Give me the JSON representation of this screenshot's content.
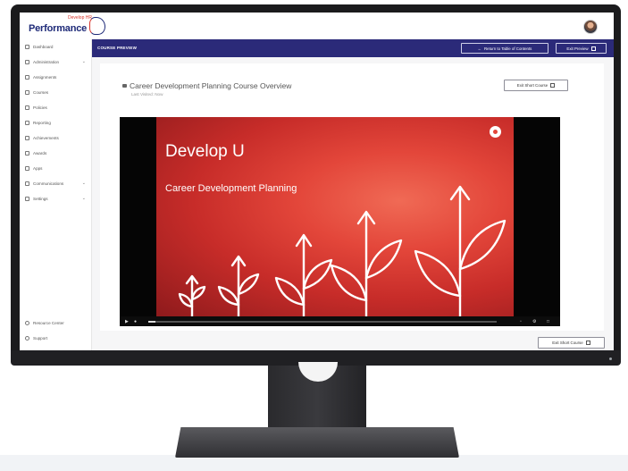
{
  "app": {
    "logo_text": "Performance",
    "logo_sub": "Develop HR"
  },
  "sidebar": {
    "items": [
      {
        "label": "Dashboard",
        "icon": "dashboard-icon"
      },
      {
        "label": "Administration",
        "icon": "admin-icon",
        "expandable": true
      },
      {
        "label": "Assignments",
        "icon": "assignments-icon"
      },
      {
        "label": "Courses",
        "icon": "courses-icon"
      },
      {
        "label": "Policies",
        "icon": "policies-icon"
      },
      {
        "label": "Reporting",
        "icon": "reporting-icon"
      },
      {
        "label": "Achievements",
        "icon": "achievements-icon"
      },
      {
        "label": "Awards",
        "icon": "awards-icon"
      },
      {
        "label": "Apps",
        "icon": "apps-icon"
      },
      {
        "label": "Communications",
        "icon": "communications-icon",
        "expandable": true
      },
      {
        "label": "Settings",
        "icon": "settings-icon",
        "expandable": true
      }
    ],
    "footer": [
      {
        "label": "Resource Center",
        "icon": "resource-center-icon"
      },
      {
        "label": "Support",
        "icon": "support-icon"
      }
    ]
  },
  "preview_bar": {
    "title": "COURSE PREVIEW",
    "return_label": "Return to Table of Contents",
    "exit_preview_label": "Exit Preview"
  },
  "course": {
    "title": "Career Development Planning Course Overview",
    "last_visited": "Last Visited: Now",
    "exit_short_course_label": "Exit Short Course"
  },
  "video": {
    "slide_title": "Develop U",
    "slide_subtitle": "Career Development Planning",
    "progress": 0.02
  },
  "colors": {
    "accent": "#2b2a79",
    "slide_red": "#e3463a"
  }
}
